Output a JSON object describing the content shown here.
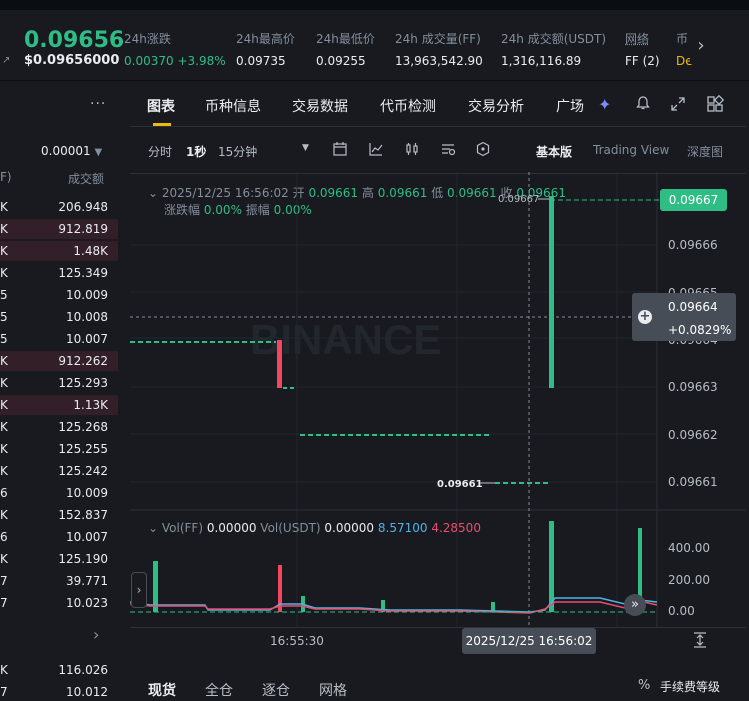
{
  "ticker": {
    "last_price": "0.09656",
    "last_price_usd": "$0.09656000",
    "stats": [
      {
        "label": "24h涨跌",
        "value": "0.00370 +3.98%"
      },
      {
        "label": "24h最高价",
        "value": "0.09735"
      },
      {
        "label": "24h最低价",
        "value": "0.09255"
      },
      {
        "label": "24h 成交量(FF)",
        "value": "13,963,542.90"
      },
      {
        "label": "24h 成交额(USDT)",
        "value": "1,316,116.89"
      },
      {
        "label": "网络",
        "value": "FF (2)"
      }
    ],
    "more_label": "币",
    "more_value": "De"
  },
  "book": {
    "tick_size": "0.00001",
    "col_price_frag": "F)",
    "col_qty": "成交额",
    "rows": [
      {
        "p": "K",
        "q": "206.948",
        "side": "none"
      },
      {
        "p": "K",
        "q": "912.819",
        "side": "red"
      },
      {
        "p": "K",
        "q": "1.48K",
        "side": "red"
      },
      {
        "p": "K",
        "q": "125.349",
        "side": "none"
      },
      {
        "p": "5",
        "q": "10.009",
        "side": "none"
      },
      {
        "p": "5",
        "q": "10.008",
        "side": "none"
      },
      {
        "p": "5",
        "q": "10.007",
        "side": "none"
      },
      {
        "p": "K",
        "q": "912.262",
        "side": "red"
      },
      {
        "p": "K",
        "q": "125.293",
        "side": "none"
      },
      {
        "p": "K",
        "q": "1.13K",
        "side": "red"
      },
      {
        "p": "K",
        "q": "125.268",
        "side": "none"
      },
      {
        "p": "K",
        "q": "125.255",
        "side": "none"
      },
      {
        "p": "K",
        "q": "125.242",
        "side": "none"
      },
      {
        "p": "6",
        "q": "10.009",
        "side": "none"
      },
      {
        "p": "K",
        "q": "152.837",
        "side": "none"
      },
      {
        "p": "6",
        "q": "10.007",
        "side": "none"
      },
      {
        "p": "K",
        "q": "125.190",
        "side": "none"
      },
      {
        "p": "7",
        "q": "39.771",
        "side": "none"
      },
      {
        "p": "7",
        "q": "10.023",
        "side": "none"
      }
    ],
    "bottom_rows": [
      {
        "p": "K",
        "q": "116.026"
      },
      {
        "p": "7",
        "q": "10.012"
      }
    ]
  },
  "panel": {
    "tabs": [
      "图表",
      "币种信息",
      "交易数据",
      "代币检测",
      "交易分析",
      "广场"
    ],
    "intervals": [
      "分时",
      "1秒",
      "15分钟"
    ],
    "views": [
      "基本版",
      "Trading View",
      "深度图"
    ]
  },
  "ohlc": {
    "time": "2025/12/25 16:56:02",
    "open_label": "开",
    "open": "0.09661",
    "high_label": "高",
    "high": "0.09661",
    "low_label": "低",
    "low": "0.09661",
    "close_label": "收",
    "close": "0.09661",
    "chg_label": "涨跌幅",
    "chg": "0.00%",
    "amp_label": "振幅",
    "amp": "0.00%"
  },
  "price_axis": [
    "0.09666",
    "0.09665",
    "0.09664",
    "0.09663",
    "0.09662",
    "0.09661"
  ],
  "current_price_tag": "0.09667",
  "crosshair_tag": {
    "price": "0.09664",
    "pct": "+0.0829%"
  },
  "chart_annotations": {
    "high_mark": "0.09667",
    "low_mark": "0.09661"
  },
  "watermark": "BINANCE",
  "volume": {
    "vol_ff_label": "Vol(FF)",
    "vol_ff": "0.00000",
    "vol_usdt_label": "Vol(USDT)",
    "vol_usdt": "0.00000",
    "ma1": "8.57100",
    "ma2": "4.28500",
    "axis": [
      "400.00",
      "200.00",
      "0.00"
    ]
  },
  "time_axis": {
    "t1": "16:55:30",
    "cursor": "2025/12/25 16:56:02"
  },
  "bottom_tabs": [
    "现货",
    "全仓",
    "逐仓",
    "网格"
  ],
  "fee_label": "手续费等级",
  "colors": {
    "up": "#2ebd85",
    "down": "#f6465d",
    "accent": "#f0b90b",
    "bg": "#181a20"
  }
}
